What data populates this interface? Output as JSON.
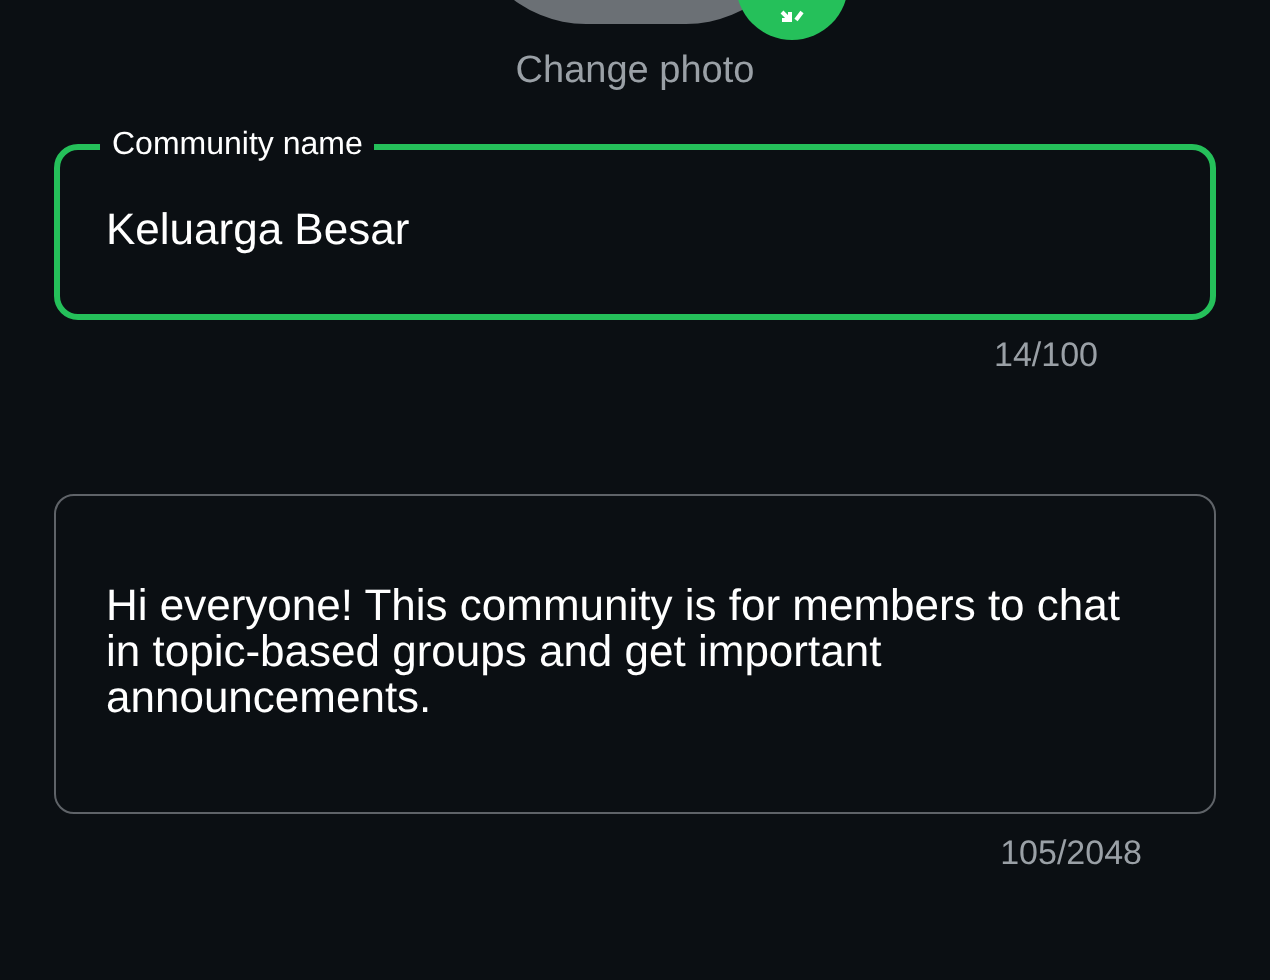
{
  "photo": {
    "action": "Change photo"
  },
  "fields": [
    {
      "label": "Community name",
      "value": "Keluarga Besar",
      "focused": true,
      "counter": "14/100"
    },
    {
      "value": "Hi everyone! This community is for members to chat in topic-based groups and get important announcements.",
      "focused": false,
      "counter": "105/2048"
    }
  ]
}
